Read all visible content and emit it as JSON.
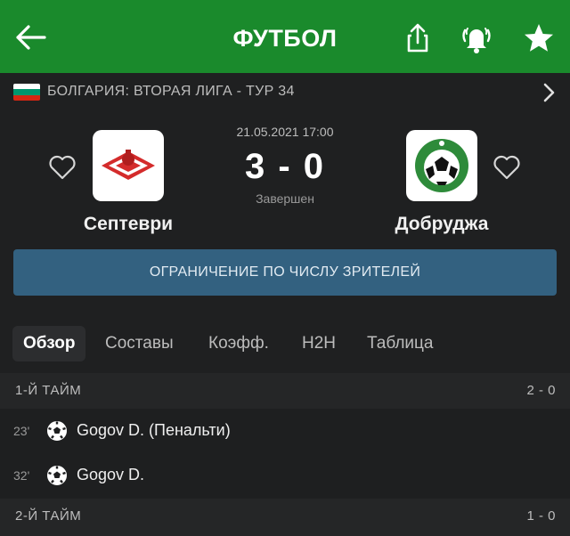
{
  "header": {
    "title": "ФУТБОЛ",
    "accent_color": "#1a8a2c"
  },
  "league": {
    "country": "БОЛГАРИЯ:",
    "name": "ВТОРАЯ ЛИГА - ТУР 34",
    "flag_colors": [
      "#ffffff",
      "#00966e",
      "#d62612"
    ]
  },
  "match": {
    "datetime": "21.05.2021 17:00",
    "score": "3 - 0",
    "status": "Завершен",
    "home": {
      "name": "Септеври"
    },
    "away": {
      "name": "Добруджа"
    }
  },
  "banner": {
    "text": "ОГРАНИЧЕНИЕ ПО ЧИСЛУ ЗРИТЕЛЕЙ",
    "color": "#336180"
  },
  "tabs": [
    {
      "label": "Обзор"
    },
    {
      "label": "Составы"
    },
    {
      "label": "Коэфф."
    },
    {
      "label": "H2H"
    },
    {
      "label": "Таблица"
    }
  ],
  "periods": [
    {
      "title": "1-Й ТАЙМ",
      "score": "2 - 0",
      "events": [
        {
          "minute": "23'",
          "player": "Gogov D. (Пенальти)",
          "icon": "soccer-ball-icon"
        },
        {
          "minute": "32'",
          "player": "Gogov D.",
          "icon": "soccer-ball-icon"
        }
      ]
    },
    {
      "title": "2-Й ТАЙМ",
      "score": "1 - 0",
      "events": []
    }
  ]
}
